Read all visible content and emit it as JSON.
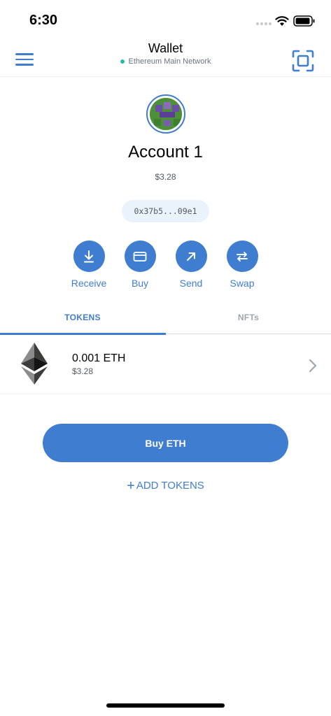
{
  "status_bar": {
    "time": "6:30"
  },
  "header": {
    "title": "Wallet",
    "network": "Ethereum Main Network",
    "network_status_color": "#29b6af"
  },
  "account": {
    "name": "Account 1",
    "balance": "$3.28",
    "address": "0x37b5...09e1"
  },
  "actions": [
    {
      "label": "Receive",
      "icon": "download-icon"
    },
    {
      "label": "Buy",
      "icon": "card-icon"
    },
    {
      "label": "Send",
      "icon": "arrow-up-right-icon"
    },
    {
      "label": "Swap",
      "icon": "swap-icon"
    }
  ],
  "tabs": [
    {
      "label": "TOKENS",
      "active": true
    },
    {
      "label": "NFTs",
      "active": false
    }
  ],
  "tokens": [
    {
      "amount": "0.001 ETH",
      "fiat": "$3.28",
      "icon": "ethereum-icon"
    }
  ],
  "buy_button": {
    "label": "Buy ETH"
  },
  "add_tokens": {
    "plus": "+",
    "label": "ADD TOKENS"
  },
  "colors": {
    "accent": "#3f7dd0",
    "pill_bg": "#eaf2fc",
    "muted": "#9fa6ae"
  }
}
